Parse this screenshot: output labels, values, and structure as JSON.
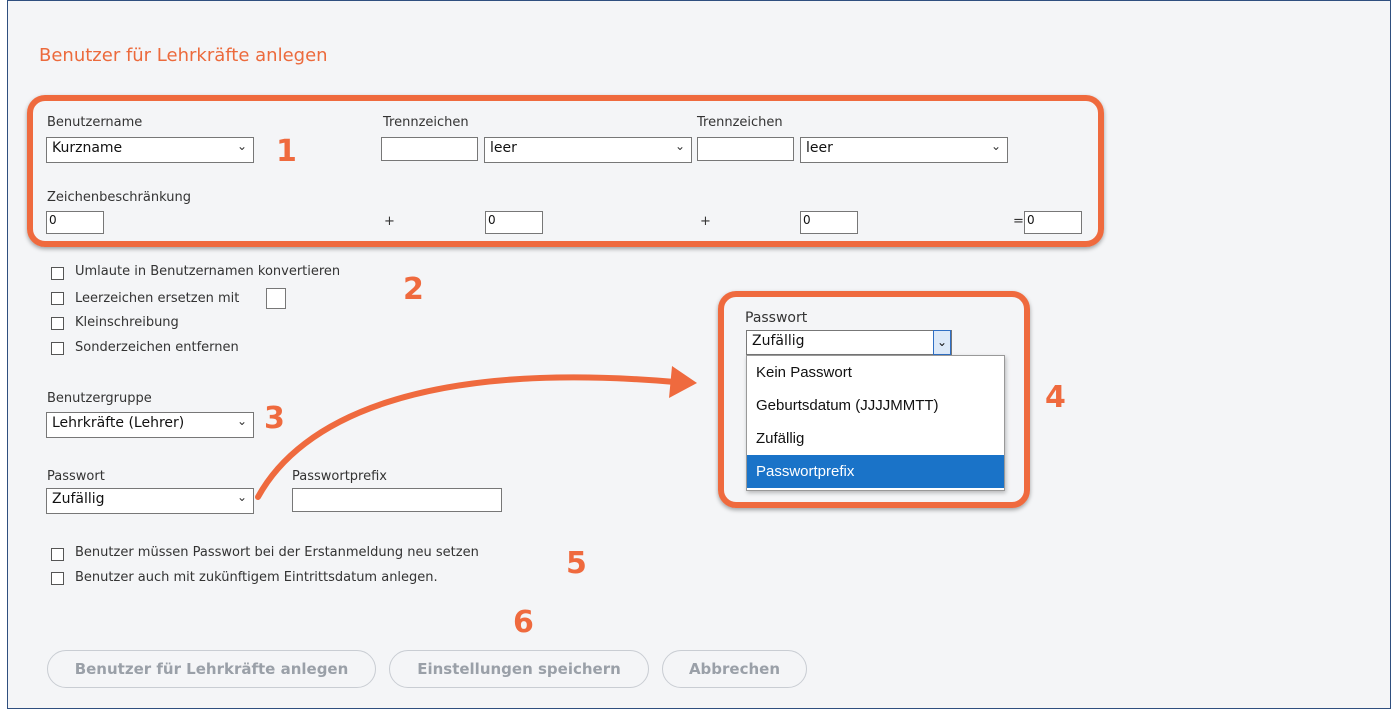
{
  "page_title": "Benutzer für Lehrkräfte anlegen",
  "username_section": {
    "benutzername_label": "Benutzername",
    "benutzername_value": "Kurzname",
    "trennzeichen1_label": "Trennzeichen",
    "trennzeichen1_input": "",
    "select2_value": "leer",
    "trennzeichen2_label": "Trennzeichen",
    "trennzeichen2_input": "",
    "select3_value": "leer",
    "zeichen_label": "Zeichenbeschränkung",
    "limit1": "0",
    "plus1": "+",
    "limit2": "0",
    "plus2": "+",
    "limit3": "0",
    "equals": "=",
    "total": "0"
  },
  "options": {
    "umlaute": "Umlaute in Benutzernamen konvertieren",
    "leerzeichen": "Leerzeichen ersetzen mit",
    "klein": "Kleinschreibung",
    "sonder": "Sonderzeichen entfernen"
  },
  "group": {
    "label": "Benutzergruppe",
    "value": "Lehrkräfte (Lehrer)"
  },
  "password": {
    "label": "Passwort",
    "value": "Zufällig",
    "prefix_label": "Passwortprefix",
    "prefix_value": ""
  },
  "checks": {
    "reset": "Benutzer müssen Passwort bei der Erstanmeldung neu setzen",
    "future": "Benutzer auch mit zukünftigem Eintrittsdatum anlegen."
  },
  "buttons": {
    "create": "Benutzer für Lehrkräfte anlegen",
    "save": "Einstellungen speichern",
    "cancel": "Abbrechen"
  },
  "popup": {
    "label": "Passwort",
    "value": "Zufällig",
    "options": [
      "Kein Passwort",
      "Geburtsdatum (JJJJMMTT)",
      "Zufällig",
      "Passwortprefix"
    ],
    "selected_index": 3
  },
  "annotations": {
    "n1": "1",
    "n2": "2",
    "n3": "3",
    "n4": "4",
    "n5": "5",
    "n6": "6",
    "color": "#ef6a3e"
  },
  "colors": {
    "title": "#ec6a3c",
    "selection": "#1a73c8"
  },
  "icons": {
    "dropdown": "chevron-down-icon",
    "arrow": "curved-arrow"
  }
}
